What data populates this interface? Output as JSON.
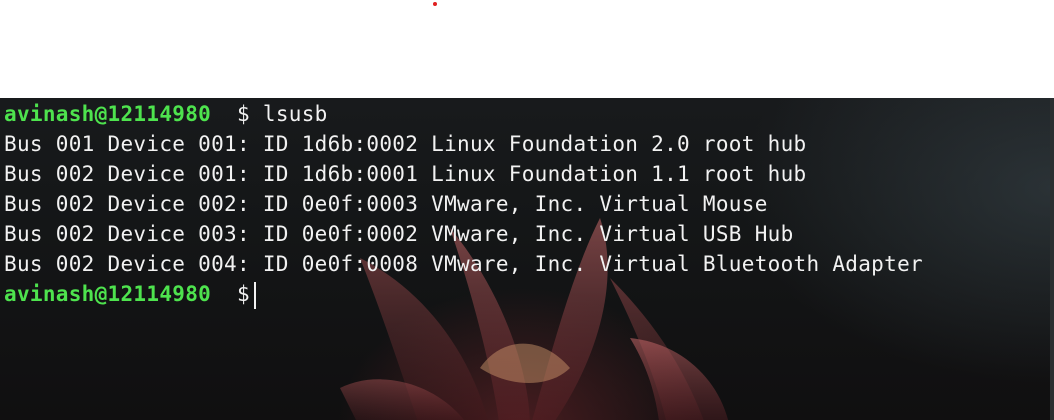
{
  "terminal": {
    "prompt_user": "avinash@12114980",
    "prompt_symbol": "$",
    "command": "lsusb",
    "output": [
      "Bus 001 Device 001: ID 1d6b:0002 Linux Foundation 2.0 root hub",
      "Bus 002 Device 001: ID 1d6b:0001 Linux Foundation 1.1 root hub",
      "Bus 002 Device 002: ID 0e0f:0003 VMware, Inc. Virtual Mouse",
      "Bus 002 Device 003: ID 0e0f:0002 VMware, Inc. Virtual USB Hub",
      "Bus 002 Device 004: ID 0e0f:0008 VMware, Inc. Virtual Bluetooth Adapter"
    ]
  },
  "colors": {
    "prompt_green": "#4ee34e",
    "text": "#f2f2f2",
    "background": "#141617"
  }
}
